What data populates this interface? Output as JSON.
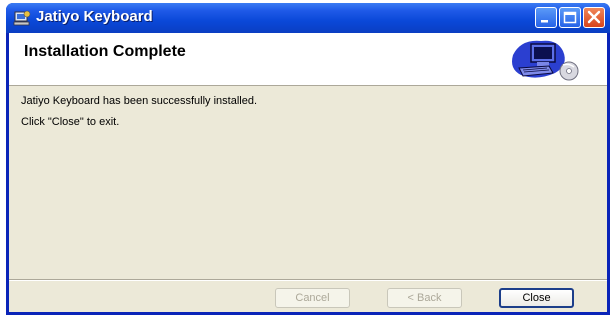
{
  "window": {
    "title": "Jatiyo Keyboard"
  },
  "header": {
    "title": "Installation Complete"
  },
  "body": {
    "message": "Jatiyo Keyboard has been successfully installed.",
    "instruction": "Click \"Close\" to exit."
  },
  "buttons": {
    "cancel": "Cancel",
    "back": "< Back",
    "close": "Close"
  },
  "colors": {
    "titlebar": "#0a48d8",
    "client_background": "#ece9d8",
    "close_button": "#d9441c"
  }
}
